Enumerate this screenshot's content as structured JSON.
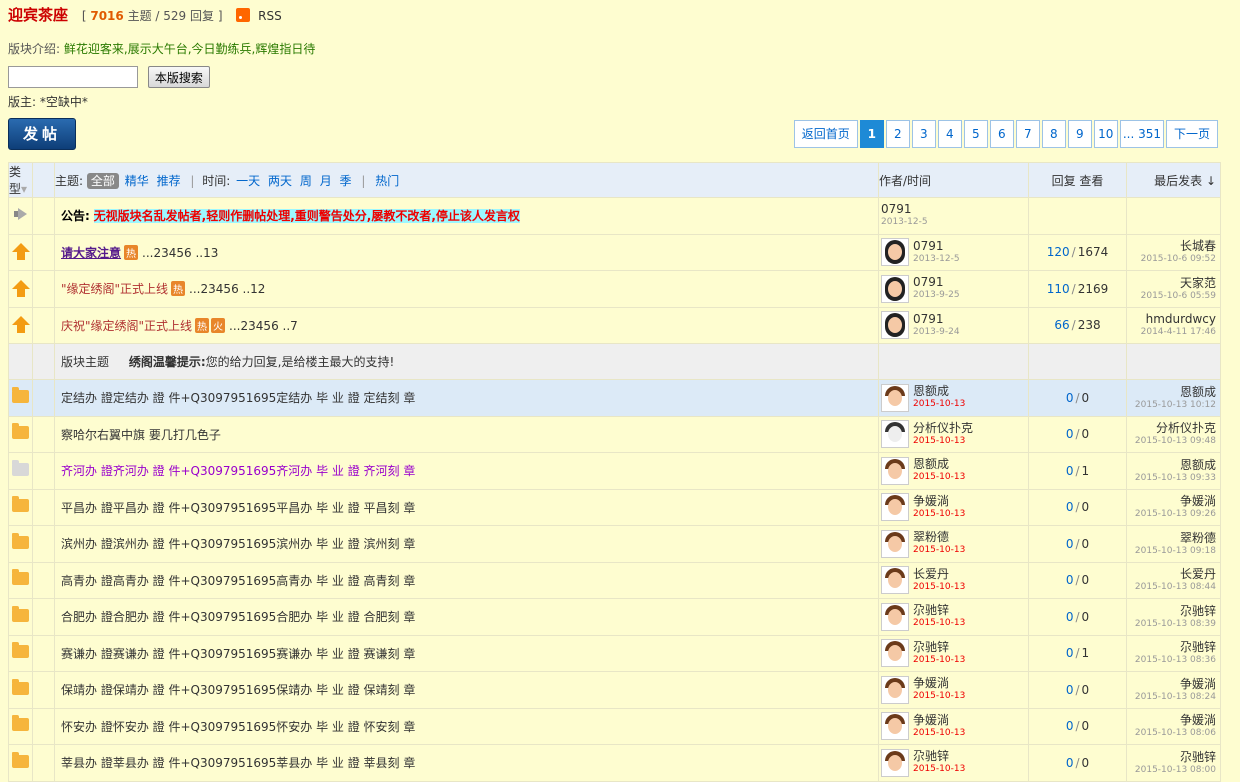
{
  "forum": {
    "title": "迎宾茶座",
    "stats_open": "[",
    "topics": "7016",
    "topics_label": "主题 /",
    "replies": "529",
    "replies_label": "回复 ]",
    "rss_label": "RSS"
  },
  "intro": {
    "label": "版块介绍:",
    "text": "鲜花迎客来,展示大午台,今日勤练兵,辉煌指日待"
  },
  "search": {
    "value": "",
    "button_label": "本版搜索"
  },
  "moderator": {
    "label": "版主:",
    "value": "*空缺中*"
  },
  "post_button": "发帖",
  "pager": {
    "home": "返回首页",
    "pages": [
      "1",
      "2",
      "3",
      "4",
      "5",
      "6",
      "7",
      "8",
      "9",
      "10"
    ],
    "current": "1",
    "last": "... 351",
    "next": "下一页"
  },
  "table_header": {
    "type": "类型",
    "subject_label": "主题:",
    "all": "全部",
    "digest": "精华",
    "recommend": "推荐",
    "time_label": "时间:",
    "day": "一天",
    "two_days": "两天",
    "week": "周",
    "month": "月",
    "season": "季",
    "hot": "热门",
    "author": "作者/时间",
    "reply_view": "回复 查看",
    "last_post": "最后发表"
  },
  "announcement": {
    "label": "公告:",
    "text": "无视版块名乱发帖者,轻则作删帖处理,重则警告处分,屡教不改者,停止该人发言权",
    "author": "0791",
    "date": "2013-12-5"
  },
  "sticky": [
    {
      "title": "请大家注意",
      "hot": "热",
      "fire": "",
      "pages": [
        "...",
        "2",
        "3",
        "4",
        "5",
        "6 ..",
        "13"
      ],
      "author": "0791",
      "date": "2013-12-5",
      "replies": "120",
      "views": "1674",
      "last_author": "长城春",
      "last_date": "2015-10-6 09:52"
    },
    {
      "title": "\"缘定绣阁\"正式上线",
      "hot": "热",
      "fire": "",
      "pages": [
        "...",
        "2",
        "3",
        "4",
        "5",
        "6 ..",
        "12"
      ],
      "author": "0791",
      "date": "2013-9-25",
      "replies": "110",
      "views": "2169",
      "last_author": "天家范",
      "last_date": "2015-10-6 05:59"
    },
    {
      "title": "庆祝\"缘定绣阁\"正式上线",
      "hot": "热",
      "fire": "火",
      "pages": [
        "...",
        "2",
        "3",
        "4",
        "5",
        "6 ..",
        "7"
      ],
      "author": "0791",
      "date": "2013-9-24",
      "replies": "66",
      "views": "238",
      "last_author": "hmdurdwcy",
      "last_date": "2014-4-11 17:46"
    }
  ],
  "separator": {
    "label": "版块主题",
    "tip_bold": "绣阁温馨提示:",
    "tip": "您的给力回复,是给楼主最大的支持!"
  },
  "threads": [
    {
      "title": "定结办 證定结办 證 件+Q3097951695定结办 毕 业 證 定结刻 章",
      "author": "恩额成",
      "date": "2015-10-13",
      "replies": "0",
      "views": "0",
      "last_author": "恩额成",
      "last_date": "2015-10-13 10:12"
    },
    {
      "title": "察哈尔右翼中旗 要几打几色子",
      "author": "分析仪扑克",
      "date": "2015-10-13",
      "replies": "0",
      "views": "0",
      "last_author": "分析仪扑克",
      "last_date": "2015-10-13 09:48"
    },
    {
      "title": "齐河办 證齐河办 證 件+Q3097951695齐河办 毕 业 證 齐河刻 章",
      "author": "恩额成",
      "date": "2015-10-13",
      "replies": "0",
      "views": "1",
      "last_author": "恩额成",
      "last_date": "2015-10-13 09:33"
    },
    {
      "title": "平昌办 證平昌办 證 件+Q3097951695平昌办 毕 业 證 平昌刻 章",
      "author": "争媛淌",
      "date": "2015-10-13",
      "replies": "0",
      "views": "0",
      "last_author": "争媛淌",
      "last_date": "2015-10-13 09:26"
    },
    {
      "title": "滨州办 證滨州办 證 件+Q3097951695滨州办 毕 业 證 滨州刻 章",
      "author": "翠粉德",
      "date": "2015-10-13",
      "replies": "0",
      "views": "0",
      "last_author": "翠粉德",
      "last_date": "2015-10-13 09:18"
    },
    {
      "title": "高青办 證高青办 證 件+Q3097951695高青办 毕 业 證 高青刻 章",
      "author": "长爱丹",
      "date": "2015-10-13",
      "replies": "0",
      "views": "0",
      "last_author": "长爱丹",
      "last_date": "2015-10-13 08:44"
    },
    {
      "title": "合肥办 證合肥办 證 件+Q3097951695合肥办 毕 业 證 合肥刻 章",
      "author": "尕驰锌",
      "date": "2015-10-13",
      "replies": "0",
      "views": "0",
      "last_author": "尕驰锌",
      "last_date": "2015-10-13 08:39"
    },
    {
      "title": "赛谦办 證赛谦办 證 件+Q3097951695赛谦办 毕 业 證 赛谦刻 章",
      "author": "尕驰锌",
      "date": "2015-10-13",
      "replies": "0",
      "views": "1",
      "last_author": "尕驰锌",
      "last_date": "2015-10-13 08:36"
    },
    {
      "title": "保靖办 證保靖办 證 件+Q3097951695保靖办 毕 业 證 保靖刻 章",
      "author": "争媛淌",
      "date": "2015-10-13",
      "replies": "0",
      "views": "0",
      "last_author": "争媛淌",
      "last_date": "2015-10-13 08:24"
    },
    {
      "title": "怀安办 證怀安办 證 件+Q3097951695怀安办 毕 业 證 怀安刻 章",
      "author": "争媛淌",
      "date": "2015-10-13",
      "replies": "0",
      "views": "0",
      "last_author": "争媛淌",
      "last_date": "2015-10-13 08:06"
    },
    {
      "title": "莘县办 證莘县办 證 件+Q3097951695莘县办 毕 业 證 莘县刻 章",
      "author": "尕驰锌",
      "date": "2015-10-13",
      "replies": "0",
      "views": "0",
      "last_author": "尕驰锌",
      "last_date": "2015-10-13 08:00"
    }
  ]
}
